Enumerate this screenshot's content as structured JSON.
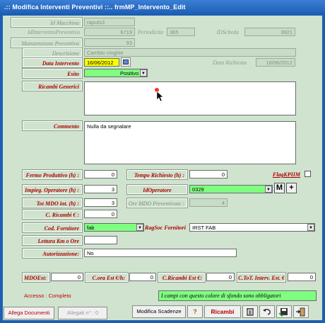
{
  "window": {
    "title": ".:: Modifica Interventi Preventivi ::..    frmMP_Intervento_Edit"
  },
  "fields": {
    "id_macchina": {
      "label": "Id Macchina",
      "value": "raputs3"
    },
    "id_intervento_preventivo": {
      "label": "IdInterventoPreventivo",
      "value": "6719"
    },
    "periodicita": {
      "label": "Periodicita",
      "value": "365"
    },
    "id_scheda": {
      "label": "IDScheda",
      "value": "3921"
    },
    "manutenzione_preventiva": {
      "label": "Manutenzione Preventiva",
      "value": "93"
    },
    "descrizione": {
      "label": "Descrizione",
      "value": "Cambio cinghie"
    },
    "data_intervento": {
      "label": "Data Intervento",
      "value": "16/06/2012"
    },
    "data_richiesta": {
      "label": "Data Richiesta",
      "value": "16/06/2012"
    },
    "esito": {
      "label": "Esito",
      "value": "Positivo"
    },
    "ricambi_generici": {
      "label": "Ricambi Generici",
      "value": ""
    },
    "commento": {
      "label": "Commento",
      "value": "Nulla da segnalare"
    },
    "fermo_produttivo": {
      "label": "Fermo Produttivo (h) :",
      "value": "0"
    },
    "tempo_richiesto": {
      "label": "Tempo Richiesto (h) :",
      "value": "0"
    },
    "flag_kpi": {
      "label": "FlagKPIIM"
    },
    "impieg_operatore": {
      "label": "Impieg. Operatore (h) :",
      "value": "3"
    },
    "id_operatore": {
      "label": "IdOperatore",
      "value": "0329"
    },
    "tot_mdo": {
      "label": "Tot MDO int. (h) :",
      "value": "3"
    },
    "ore_mdo_preventivate": {
      "label": "Ore MDO Preventivate :",
      "value": "4"
    },
    "c_ricambi": {
      "label": "C. Ricambi € :",
      "value": "0"
    },
    "cod_fornitore": {
      "label": "Cod. Fornitore",
      "value": "fab"
    },
    "ragsoc_fornitori": {
      "label": "RagSoc Fornitori",
      "value": "IRST FAB"
    },
    "lettura_km": {
      "label": "Lettura Km o Ore",
      "value": ""
    },
    "autorizzazione": {
      "label": "Autorizzazione:",
      "value": "No"
    },
    "mdo_est": {
      "label": "MDOEst:",
      "value": "0"
    },
    "c_ora_est": {
      "label": "C.ora Est €/h:",
      "value": "0"
    },
    "c_ricambi_est": {
      "label": "C.Ricambi Est €:",
      "value": "0"
    },
    "c_tot_interv_est": {
      "label": "C.ToT. Interv. Est. €",
      "value": "0"
    }
  },
  "status": {
    "access": "Accesso : Completo",
    "required_note": "I campi con questo colore di sfondo sono obbligatori"
  },
  "buttons": {
    "m": "M",
    "plus": "+",
    "allega_documenti": "Allega Documenti",
    "allegati": "Allegati n° : 0",
    "modifica_scadenze": "Modifica Scadenze",
    "help": "?",
    "ricambi": "Ricambi"
  },
  "colors": {
    "background": "#cfe3cf",
    "required": "#7fff7f",
    "date_highlight": "#ffff00",
    "label_red": "#b00000"
  }
}
